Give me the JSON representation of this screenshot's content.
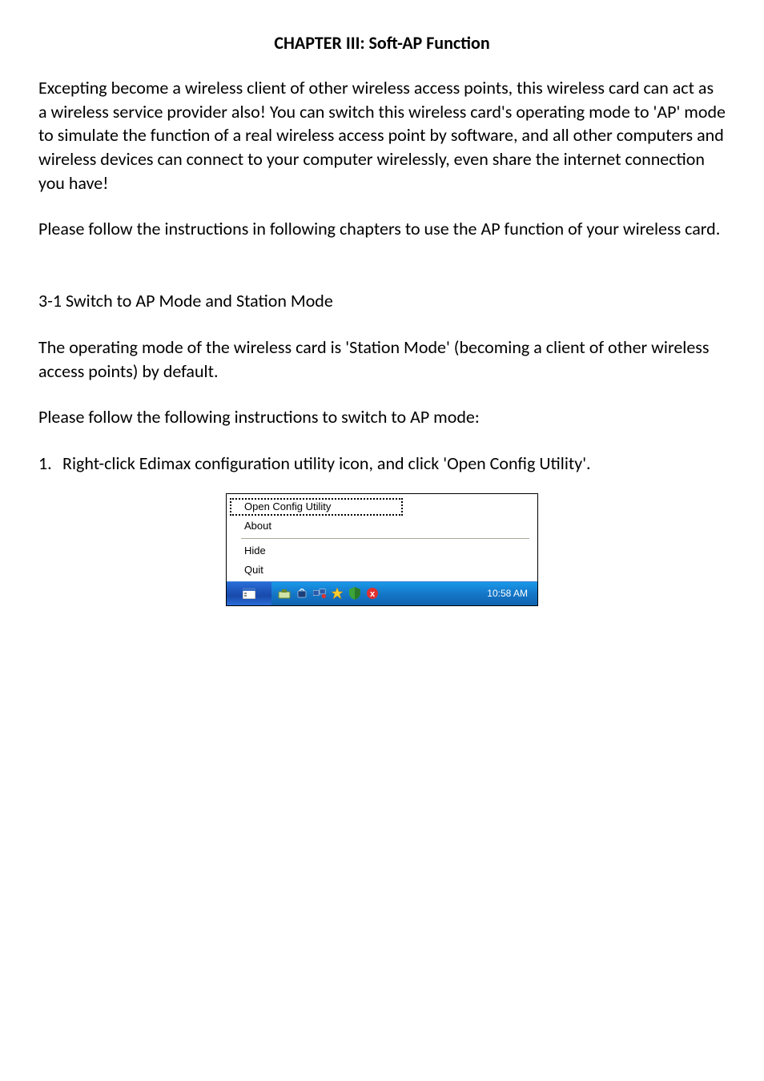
{
  "title": "CHAPTER III: Soft-AP Function",
  "para1": "Excepting become a wireless client of other wireless access points, this wireless card can act as a wireless service provider also! You can switch this wireless card's operating mode to 'AP' mode to simulate the function of a real wireless access point by software, and all other computers and wireless devices can connect to your computer wirelessly, even share the internet connection you have!",
  "para2": "Please follow the instructions in following chapters to use the AP function of your wireless card.",
  "section_heading": "3-1 Switch to AP Mode and Station Mode",
  "para3": "The operating mode of the wireless card is 'Station Mode' (becoming a client of other wireless access points) by default.",
  "para4": "Please follow the following instructions to switch to AP mode:",
  "step1_num": "1.",
  "step1_text": "Right-click Edimax configuration utility icon, and click 'Open Config Utility'.",
  "context_menu": {
    "open": "Open Config Utility",
    "about": "About",
    "hide": "Hide",
    "quit": "Quit"
  },
  "taskbar": {
    "clock": "10:58 AM"
  }
}
